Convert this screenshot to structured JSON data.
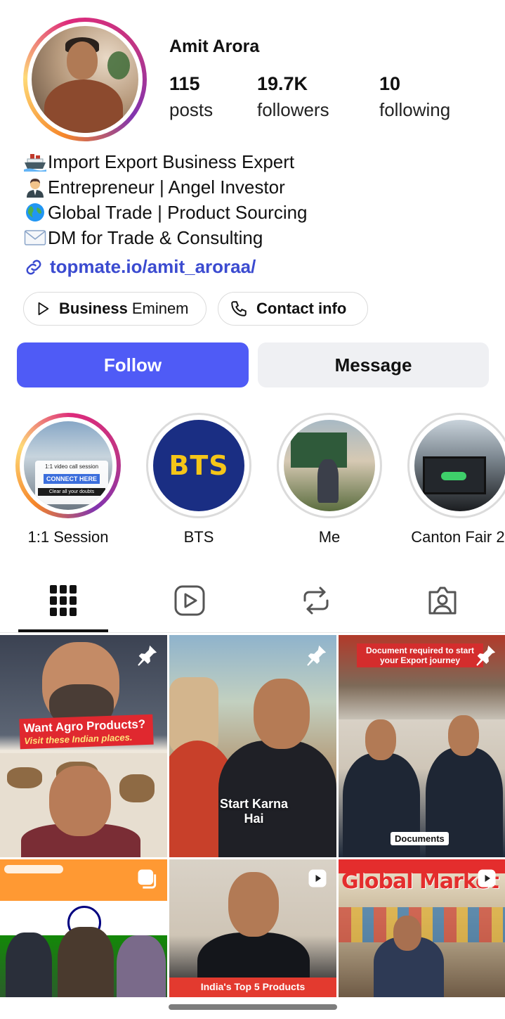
{
  "profile": {
    "name": "Amit Arora",
    "stats": {
      "posts_count": "115",
      "posts_label": "posts",
      "followers_count": "19.7K",
      "followers_label": "followers",
      "following_count": "10",
      "following_label": "following"
    },
    "bio": [
      {
        "icon": "ship-emoji",
        "text": "Import Export Business Expert"
      },
      {
        "icon": "businessman-emoji",
        "text": "Entrepreneur | Angel Investor"
      },
      {
        "icon": "globe-emoji",
        "text": "Global Trade | Product Sourcing"
      },
      {
        "icon": "envelope-emoji",
        "text": "DM for Trade & Consulting"
      }
    ],
    "link": "topmate.io/amit_aroraa/"
  },
  "chips": {
    "business_bold": "Business",
    "business_rest": "Eminem",
    "contact": "Contact info"
  },
  "actions": {
    "follow": "Follow",
    "message": "Message"
  },
  "highlights": [
    {
      "label": "1:1 Session",
      "card_title": "1:1 video call session",
      "card_cta": "CONNECT HERE",
      "card_sub": "Clear all your doubts"
    },
    {
      "label": "BTS",
      "logo": "BTS"
    },
    {
      "label": "Me"
    },
    {
      "label": "Canton Fair 2."
    }
  ],
  "tabs": [
    {
      "icon": "grid-icon",
      "active": true
    },
    {
      "icon": "reels-icon",
      "active": false
    },
    {
      "icon": "repost-icon",
      "active": false
    },
    {
      "icon": "tagged-icon",
      "active": false
    }
  ],
  "posts": [
    {
      "pinned": true,
      "caption_1": "Want Agro Products?",
      "caption_2": "Visit these Indian places."
    },
    {
      "pinned": true,
      "caption": "Start Karna\nHai"
    },
    {
      "pinned": true,
      "caption_1": "Document required to start your Export journey",
      "tag": "Documents"
    },
    {
      "type": "carousel"
    },
    {
      "type": "reel",
      "caption": "India's Top 5 Products"
    },
    {
      "type": "reel",
      "caption": "Global Market"
    }
  ],
  "colors": {
    "accent": "#4f5bf6",
    "link": "#3b4bd0",
    "message_bg": "#eff0f3"
  }
}
